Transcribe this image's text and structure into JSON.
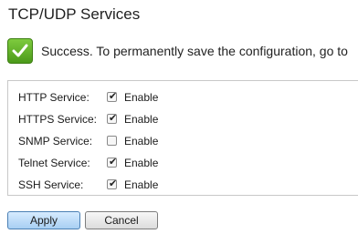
{
  "page": {
    "title": "TCP/UDP Services"
  },
  "notification": {
    "icon": "success-check-icon",
    "message": "Success. To permanently save the configuration, go to"
  },
  "services": [
    {
      "label": "HTTP Service:",
      "checked": true,
      "option": "Enable"
    },
    {
      "label": "HTTPS Service:",
      "checked": true,
      "option": "Enable"
    },
    {
      "label": "SNMP Service:",
      "checked": false,
      "option": "Enable"
    },
    {
      "label": "Telnet Service:",
      "checked": true,
      "option": "Enable"
    },
    {
      "label": "SSH Service:",
      "checked": true,
      "option": "Enable"
    }
  ],
  "buttons": {
    "apply_label": "Apply",
    "cancel_label": "Cancel"
  },
  "colors": {
    "success_green": "#5cb02a",
    "apply_blue": "#a8cff3"
  }
}
